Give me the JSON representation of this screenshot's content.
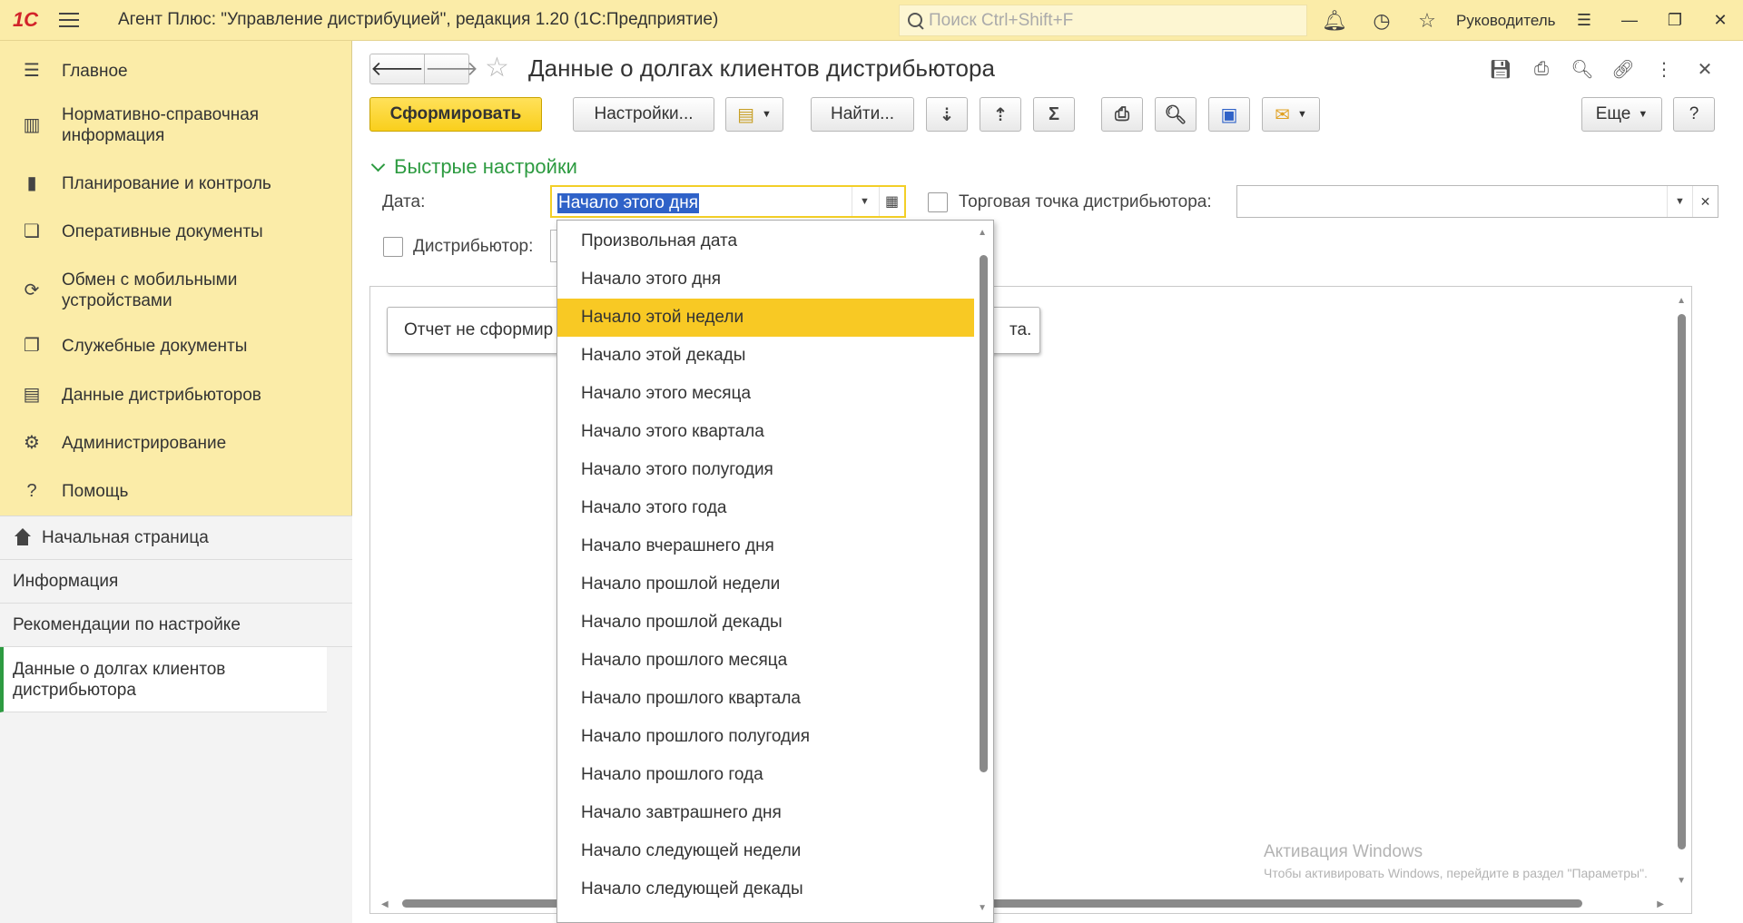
{
  "app": {
    "logo": "1С",
    "title": "Агент Плюс: \"Управление дистрибуцией\", редакция 1.20  (1С:Предприятие)",
    "search_placeholder": "Поиск Ctrl+Shift+F",
    "user": "Руководитель"
  },
  "sidebar": {
    "items": [
      {
        "label": "Главное",
        "icon": "menu-lines-icon"
      },
      {
        "label": "Нормативно-справочная информация",
        "icon": "catalog-icon"
      },
      {
        "label": "Планирование и контроль",
        "icon": "bar-chart-icon"
      },
      {
        "label": "Оперативные документы",
        "icon": "documents-icon"
      },
      {
        "label": "Обмен с мобильными устройствами",
        "icon": "sync-icon"
      },
      {
        "label": "Служебные документы",
        "icon": "service-docs-icon"
      },
      {
        "label": "Данные дистрибьюторов",
        "icon": "distributor-data-icon"
      },
      {
        "label": "Администрирование",
        "icon": "gear-icon"
      },
      {
        "label": "Помощь",
        "icon": "question-icon"
      }
    ],
    "links": [
      {
        "label": "Начальная страница"
      },
      {
        "label": "Информация"
      },
      {
        "label": "Рекомендации по настройке"
      },
      {
        "label": "Данные о долгах клиентов дистрибьютора"
      }
    ]
  },
  "form": {
    "title": "Данные о долгах клиентов дистрибьютора",
    "toolbar": {
      "generate": "Сформировать",
      "settings": "Настройки...",
      "find": "Найти...",
      "more": "Еще",
      "help": "?"
    },
    "quick_settings": "Быстрые настройки",
    "date_label": "Дата:",
    "date_value": "Начало этого дня",
    "trade_point_label": "Торговая точка дистрибьютора:",
    "trade_point_value": "",
    "distributor_label": "Дистрибьютор:",
    "report_message_left": "Отчет не сформир",
    "report_message_right": "та."
  },
  "activation": {
    "title": "Активация Windows",
    "subtitle": "Чтобы активировать Windows, перейдите в раздел \"Параметры\"."
  },
  "dropdown": {
    "selected": "Начало этой недели",
    "options": [
      "Произвольная дата",
      "Начало этого дня",
      "Начало этой недели",
      "Начало этой декады",
      "Начало этого месяца",
      "Начало этого квартала",
      "Начало этого полугодия",
      "Начало этого года",
      "Начало вчерашнего дня",
      "Начало прошлой недели",
      "Начало прошлой декады",
      "Начало прошлого месяца",
      "Начало прошлого квартала",
      "Начало прошлого полугодия",
      "Начало прошлого года",
      "Начало завтрашнего дня",
      "Начало следующей недели",
      "Начало следующей декады"
    ]
  },
  "colors": {
    "chrome": "#fbeca8",
    "accent": "#f8c924",
    "green": "#2d9b41"
  }
}
